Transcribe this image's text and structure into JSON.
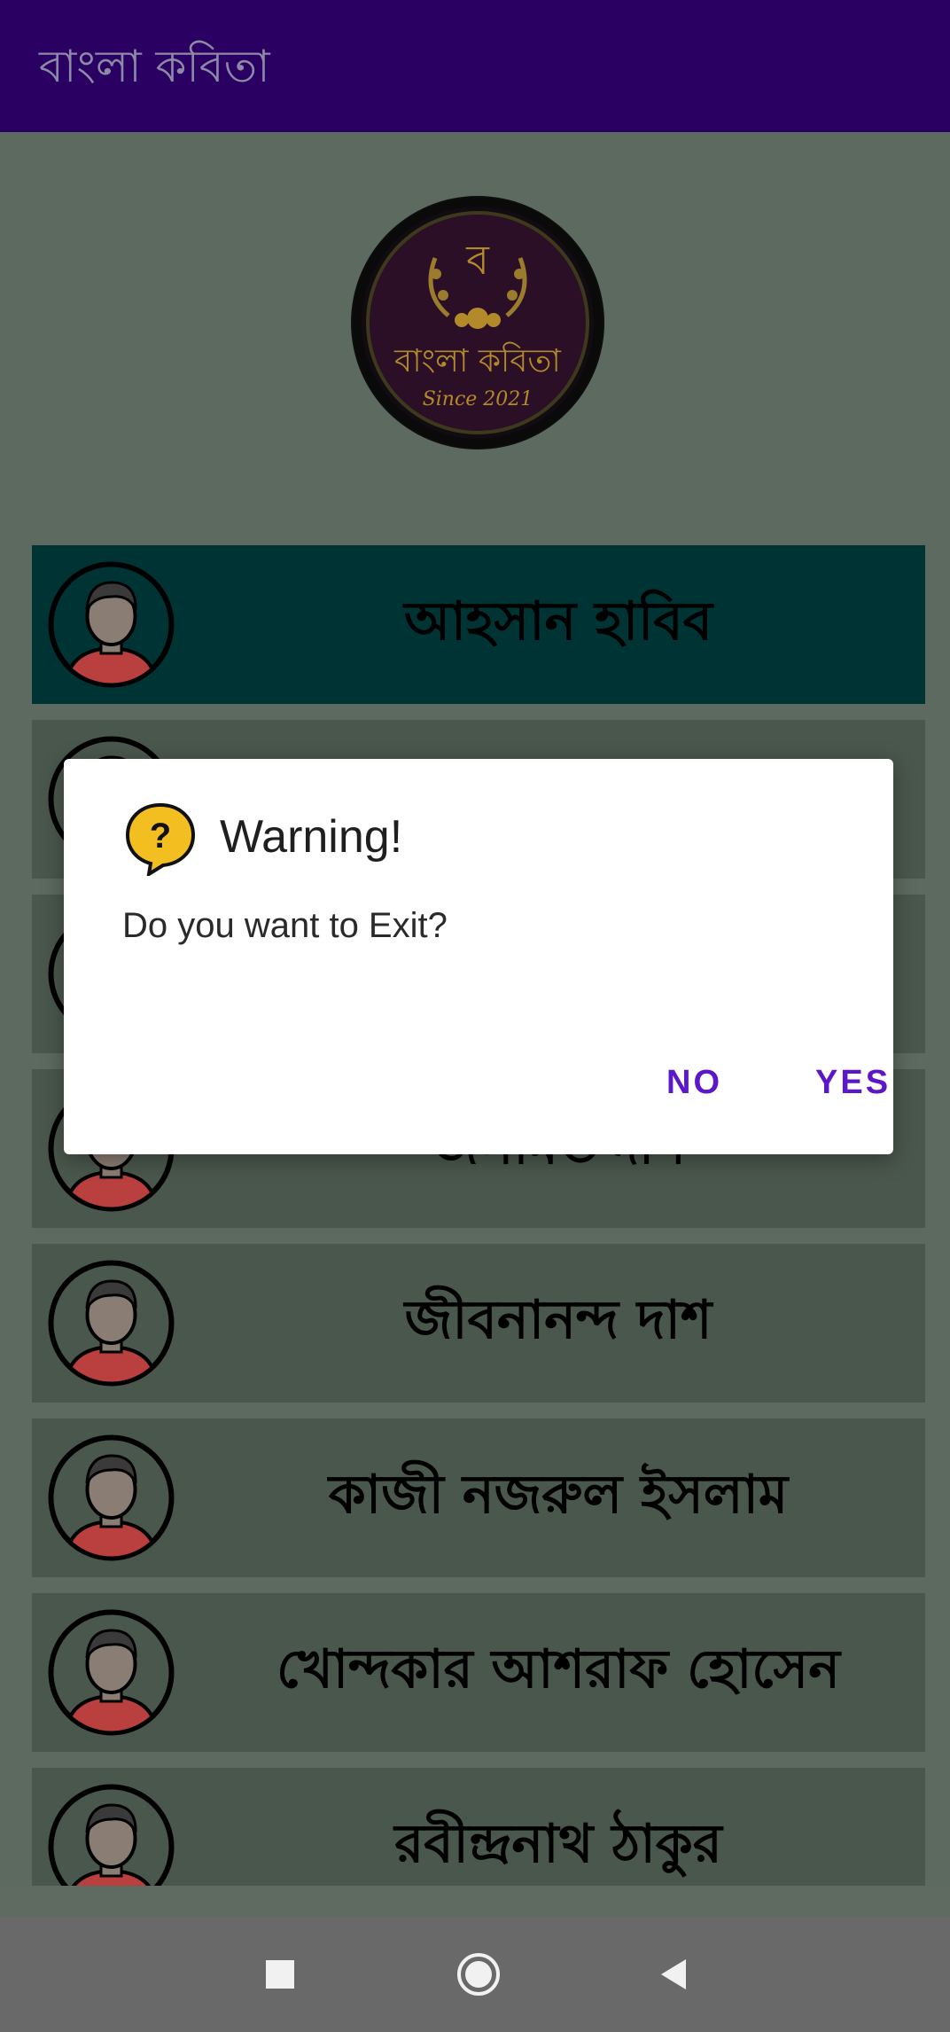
{
  "app": {
    "title": "বাংলা কবিতা"
  },
  "logo": {
    "letter": "ব",
    "name": "বাংলা কবিতা",
    "since": "Since 2021"
  },
  "poets": [
    {
      "name": "আহসান হাবিব",
      "selected": true
    },
    {
      "name": "",
      "selected": false
    },
    {
      "name": "",
      "selected": false
    },
    {
      "name": "জসীমউদ্দীন",
      "selected": false
    },
    {
      "name": "জীবনানন্দ দাশ",
      "selected": false
    },
    {
      "name": "কাজী নজরুল ইসলাম",
      "selected": false
    },
    {
      "name": "খোন্দকার আশরাফ হোসেন",
      "selected": false
    },
    {
      "name": "রবীন্দ্রনাথ ঠাকুর",
      "selected": false
    }
  ],
  "dialog": {
    "icon": "question-bubble-icon",
    "title": "Warning!",
    "message": "Do you want to Exit?",
    "no_label": "NO",
    "yes_label": "YES"
  },
  "colors": {
    "appbar": "#2a0062",
    "selected_row": "#003434",
    "row": "#4a574c",
    "button_text": "#5b17c9"
  },
  "navbar": {
    "icons": [
      "recents-square-icon",
      "home-circle-icon",
      "back-triangle-icon"
    ]
  }
}
